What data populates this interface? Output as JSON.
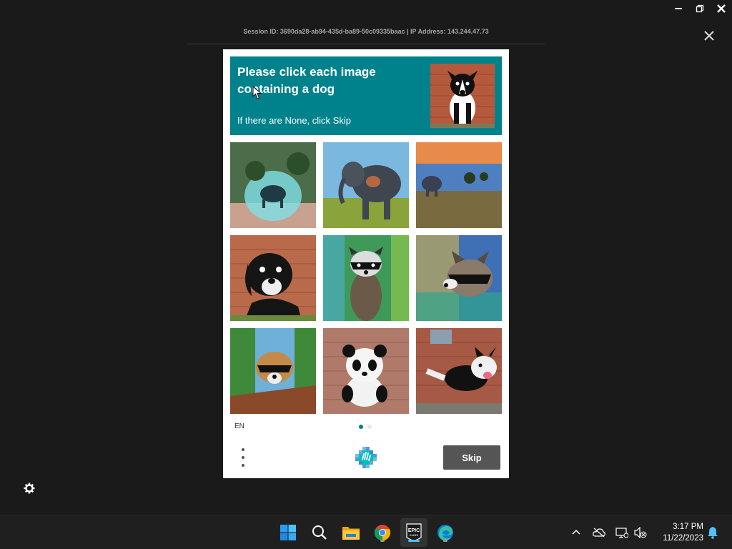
{
  "session": {
    "info": "Session ID: 3690da28-ab94-435d-ba89-50c09335baac | IP Address: 143.244.47.73"
  },
  "captcha": {
    "prompt_title": "Please click each image containing a dog",
    "prompt_sub": "If there are None, click Skip",
    "example_image": "dog-example",
    "tiles": [
      {
        "subject": "elephant under glowing dome"
      },
      {
        "subject": "elephant in savanna"
      },
      {
        "subject": "elephant at sunset"
      },
      {
        "subject": "dog on brick wall"
      },
      {
        "subject": "raccoon in forest"
      },
      {
        "subject": "raccoon colorful"
      },
      {
        "subject": "raccoon on log"
      },
      {
        "subject": "panda on brick wall"
      },
      {
        "subject": "dog jumping from wall"
      }
    ],
    "language": "EN",
    "pagination": {
      "current": 1,
      "total": 2
    },
    "skip_label": "Skip"
  },
  "taskbar": {
    "apps": [
      "Start",
      "Search",
      "File Explorer",
      "Google Chrome",
      "Epic Games Launcher",
      "Microsoft Edge"
    ],
    "clock_time": "3:17 PM",
    "clock_date": "11/22/2023"
  },
  "colors": {
    "accent": "#00828c",
    "background": "#1a1a1a",
    "skip_button": "#555555"
  }
}
